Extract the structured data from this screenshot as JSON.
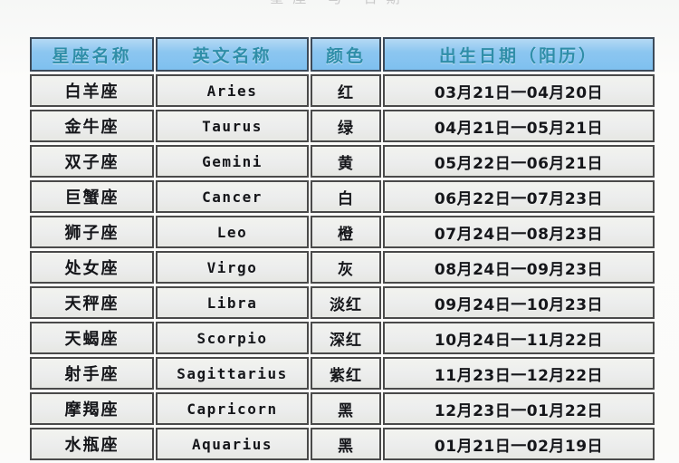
{
  "page": {
    "top_cut_text": "星座  与  日期"
  },
  "table": {
    "headers": [
      "星座名称",
      "英文名称",
      "颜色",
      "出生日期（阳历）"
    ],
    "rows": [
      {
        "name": "白羊座",
        "english": "Aries",
        "color": "红",
        "date": "03月21日一04月20日"
      },
      {
        "name": "金牛座",
        "english": "Taurus",
        "color": "绿",
        "date": "04月21日一05月21日"
      },
      {
        "name": "双子座",
        "english": "Gemini",
        "color": "黄",
        "date": "05月22日一06月21日"
      },
      {
        "name": "巨蟹座",
        "english": "Cancer",
        "color": "白",
        "date": "06月22日一07月23日"
      },
      {
        "name": "狮子座",
        "english": "Leo",
        "color": "橙",
        "date": "07月24日一08月23日"
      },
      {
        "name": "处女座",
        "english": "Virgo",
        "color": "灰",
        "date": "08月24日一09月23日"
      },
      {
        "name": "天秤座",
        "english": "Libra",
        "color": "淡红",
        "date": "09月24日一10月23日"
      },
      {
        "name": "天蝎座",
        "english": "Scorpio",
        "color": "深红",
        "date": "10月24日一11月22日"
      },
      {
        "name": "射手座",
        "english": "Sagittarius",
        "color": "紫红",
        "date": "11月23日一12月22日"
      },
      {
        "name": "摩羯座",
        "english": "Capricorn",
        "color": "黑",
        "date": "12月23日一01月22日"
      },
      {
        "name": "水瓶座",
        "english": "Aquarius",
        "color": "黑",
        "date": "01月21日一02月19日"
      }
    ]
  },
  "colors": {
    "header_fill": "#7ec0ef",
    "header_text": "#2f8ea8",
    "cell_fill": "#eceded",
    "cell_border": "#4a4a4a",
    "page_background": "#fbfbfa"
  }
}
